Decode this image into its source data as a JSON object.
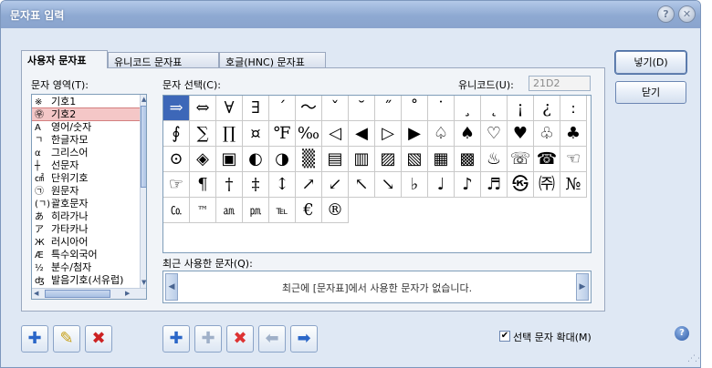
{
  "window": {
    "title": "문자표 입력",
    "help": "?",
    "close": "✕"
  },
  "tabs": [
    "사용자 문자표",
    "유니코드 문자표",
    "호글(HNC) 문자표"
  ],
  "labels": {
    "area": "문자 영역(T):",
    "select": "문자 선택(C):",
    "unicode": "유니코드(U):",
    "recent": "최근 사용한 문자(Q):"
  },
  "unicode_value": "21D2",
  "areas": [
    {
      "icon": "※",
      "label": "기호1"
    },
    {
      "icon": "㉾",
      "label": "기호2"
    },
    {
      "icon": "A",
      "label": "영어/숫자"
    },
    {
      "icon": "ㄱ",
      "label": "한글자모"
    },
    {
      "icon": "α",
      "label": "그리스어"
    },
    {
      "icon": "┼",
      "label": "선문자"
    },
    {
      "icon": "㎠",
      "label": "단위기호"
    },
    {
      "icon": "㉠",
      "label": "원문자"
    },
    {
      "icon": "(ㄱ)",
      "label": "괄호문자"
    },
    {
      "icon": "あ",
      "label": "히라가나"
    },
    {
      "icon": "ア",
      "label": "가타카나"
    },
    {
      "icon": "Ж",
      "label": "러시아어"
    },
    {
      "icon": "Æ",
      "label": "특수외국어"
    },
    {
      "icon": "½",
      "label": "분수/첨자"
    },
    {
      "icon": "ʤ",
      "label": "발음기호(서유럽)"
    }
  ],
  "selected_area": 1,
  "symbols": [
    [
      "⇒",
      "⇔",
      "∀",
      "∃",
      "´",
      "～",
      "ˇ",
      "˘",
      "˝",
      "˚",
      "˙",
      "¸",
      "˛",
      "¡",
      "¿",
      "ː"
    ],
    [
      "∮",
      "∑",
      "∏",
      "¤",
      "℉",
      "‰",
      "◁",
      "◀",
      "▷",
      "▶",
      "♤",
      "♠",
      "♡",
      "♥",
      "♧",
      "♣"
    ],
    [
      "⊙",
      "◈",
      "▣",
      "◐",
      "◑",
      "▒",
      "▤",
      "▥",
      "▨",
      "▧",
      "▦",
      "▩",
      "♨",
      "☏",
      "☎",
      "☜"
    ],
    [
      "☞",
      "¶",
      "†",
      "‡",
      "↕",
      "↗",
      "↙",
      "↖",
      "↘",
      "♭",
      "♩",
      "♪",
      "♬",
      "㉿",
      "㈜",
      "№"
    ],
    [
      "㏇",
      "™",
      "㏂",
      "㏘",
      "℡",
      "€",
      "®"
    ]
  ],
  "recent_message": "최근에 [문자표]에서 사용한 문자가 없습니다.",
  "buttons": {
    "insert": "넣기(D)",
    "close": "닫기"
  },
  "enlarge": {
    "label": "선택 문자 확대(M)",
    "checked": "✔"
  },
  "toolbar_icons": [
    "add-area-icon",
    "edit-area-icon",
    "delete-area-icon",
    "add-char-icon",
    "add-char-disabled-icon",
    "delete-char-icon",
    "move-left-icon",
    "move-right-icon"
  ]
}
